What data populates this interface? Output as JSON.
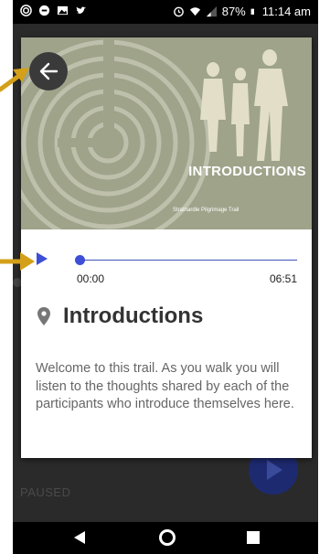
{
  "status_bar": {
    "battery": "87%",
    "time": "11:14 am"
  },
  "card": {
    "hero": {
      "title": "INTRODUCTIONS",
      "subtitle": "Strathardle Pilgrimage Trail"
    },
    "player": {
      "current_time": "00:00",
      "duration": "06:51",
      "progress": 0.0
    },
    "place_title": "Introductions",
    "description": "Welcome to this trail.  As you walk you will listen to the thoughts shared by each of the participants who introduce themselves here."
  },
  "background_app": {
    "status_label": "PAUSED"
  },
  "colors": {
    "accent": "#3d4fd6",
    "hero_bg": "#9ea38a",
    "annotation": "#d4a019"
  }
}
